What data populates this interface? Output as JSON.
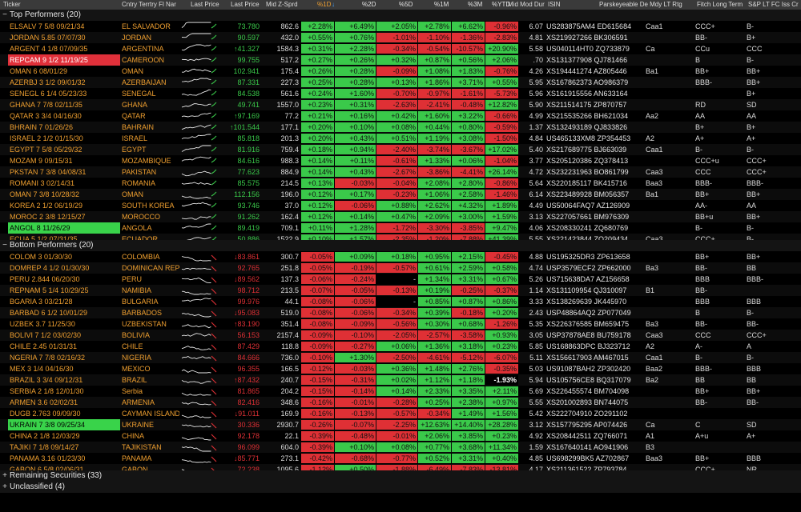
{
  "columns": {
    "ticker": "Ticker",
    "country": "Cntry Terrtry Fl Nar",
    "last_price_chart": "Last Price",
    "last_price": "Last Price",
    "mid_z": "Mid Z-Sprd",
    "p1d": "%1D",
    "p1d_sort": "↓",
    "p2d": "%2D",
    "p5d": "%5D",
    "p1m": "%1M",
    "p3m": "%3M",
    "pytd": "%YTD",
    "dur": "Mid Mod Dur",
    "isin": "ISIN",
    "moody": "Parskeyeable De Mdy LT Rtg",
    "fitch": "Fitch Long Term",
    "sp": "S&P LT FC Iss Cr"
  },
  "groups": {
    "top": {
      "label": "Top Performers (20)",
      "toggle": "−"
    },
    "bottom": {
      "label": "Bottom Performers (20)",
      "toggle": "−"
    },
    "remaining": {
      "label": "Remaining Securities (33)",
      "toggle": "+"
    },
    "unclassified": {
      "label": "Unclassified (4)",
      "toggle": "+"
    }
  },
  "colors": {
    "up": "#3ac94a",
    "down": "#df3035",
    "orange": "#f0a030"
  },
  "top_rows": [
    {
      "ticker": "ELSALV 7 5/8 09/21/34",
      "country": "EL SALVADOR",
      "lp": "73.780",
      "lp_dir": "",
      "z": "862.6",
      "d1": "+2.28%",
      "d2": "+6.49%",
      "d5": "+2.05%",
      "m1": "+2.78%",
      "m3": "+6.62%",
      "ytd": "-0.96%",
      "dur": "6.07",
      "isin": "US283875AM4 ED615684",
      "moody": "Caa1",
      "fitch": "CCC+",
      "sp": "B-",
      "hl": ""
    },
    {
      "ticker": "JORDAN 5.85 07/07/30",
      "country": "JORDAN",
      "lp": "90.597",
      "lp_dir": "",
      "z": "432.0",
      "d1": "+0.55%",
      "d2": "+0.76%",
      "d5": "-1.01%",
      "m1": "-1.10%",
      "m3": "-1.36%",
      "ytd": "-2.83%",
      "dur": "4.81",
      "isin": "XS219927266 BK306591",
      "moody": "",
      "fitch": "BB-",
      "sp": "B+",
      "hl": ""
    },
    {
      "ticker": "ARGENT 4 1/8 07/09/35",
      "country": "ARGENTINA",
      "lp": "41.327",
      "lp_dir": "up",
      "z": "1584.3",
      "d1": "+0.31%",
      "d2": "+2.28%",
      "d5": "-0.34%",
      "m1": "-0.54%",
      "m3": "-10.57%",
      "ytd": "+20.90%",
      "dur": "5.58",
      "isin": "US040114HT0 ZQ733879",
      "moody": "Ca",
      "fitch": "CCu",
      "sp": "CCC",
      "hl": ""
    },
    {
      "ticker": "REPCAM 9 1/2 11/19/25",
      "country": "CAMEROON",
      "lp": "99.755",
      "lp_dir": "",
      "z": "517.2",
      "d1": "+0.27%",
      "d2": "+0.26%",
      "d5": "+0.32%",
      "m1": "+0.87%",
      "m3": "+0.56%",
      "ytd": "+2.06%",
      "dur": ".70",
      "isin": "XS131377908 QJ781466",
      "moody": "",
      "fitch": "B",
      "sp": "B-",
      "hl": "red"
    },
    {
      "ticker": "OMAN 6 08/01/29",
      "country": "OMAN",
      "lp": "102.941",
      "lp_dir": "",
      "z": "175.4",
      "d1": "+0.26%",
      "d2": "+0.28%",
      "d5": "-0.09%",
      "m1": "+1.08%",
      "m3": "+1.83%",
      "ytd": "-0.76%",
      "dur": "4.26",
      "isin": "XS194441274 AZ805446",
      "moody": "Ba1",
      "fitch": "BB+",
      "sp": "BB+",
      "hl": ""
    },
    {
      "ticker": "AZERBJ 3 1/2 09/01/32",
      "country": "AZERBAIJAN",
      "lp": "87.331",
      "lp_dir": "",
      "z": "227.3",
      "d1": "+0.25%",
      "d2": "+0.28%",
      "d5": "+0.13%",
      "m1": "+1.86%",
      "m3": "+3.71%",
      "ytd": "+0.55%",
      "dur": "5.95",
      "isin": "XS167862373 AO986379",
      "moody": "",
      "fitch": "BBB-",
      "sp": "BB+",
      "hl": ""
    },
    {
      "ticker": "SENEGL 6 1/4 05/23/33",
      "country": "SENEGAL",
      "lp": "84.538",
      "lp_dir": "",
      "z": "561.6",
      "d1": "+0.24%",
      "d2": "+1.60%",
      "d5": "-0.70%",
      "m1": "-0.97%",
      "m3": "-1.61%",
      "ytd": "-5.73%",
      "dur": "5.96",
      "isin": "XS161915556 AN633164",
      "moody": "",
      "fitch": "",
      "sp": "B+",
      "hl": ""
    },
    {
      "ticker": "GHANA 7 7/8 02/11/35",
      "country": "GHANA",
      "lp": "49.741",
      "lp_dir": "",
      "z": "1557.0",
      "d1": "+0.23%",
      "d2": "+0.31%",
      "d5": "-2.63%",
      "m1": "-2.41%",
      "m3": "-0.48%",
      "ytd": "+12.82%",
      "dur": "5.90",
      "isin": "XS211514175 ZP870757",
      "moody": "",
      "fitch": "RD",
      "sp": "SD",
      "hl": ""
    },
    {
      "ticker": "QATAR 3 3/4 04/16/30",
      "country": "QATAR",
      "lp": "97.169",
      "lp_dir": "up",
      "z": "77.2",
      "d1": "+0.21%",
      "d2": "+0.16%",
      "d5": "+0.42%",
      "m1": "+1.60%",
      "m3": "+3.22%",
      "ytd": "-0.66%",
      "dur": "4.99",
      "isin": "XS215535266 BH621034",
      "moody": "Aa2",
      "fitch": "AA",
      "sp": "AA",
      "hl": ""
    },
    {
      "ticker": "BHRAIN 7 01/26/26",
      "country": "BAHRAIN",
      "lp": "101.544",
      "lp_dir": "up",
      "z": "177.1",
      "d1": "+0.20%",
      "d2": "+0.10%",
      "d5": "+0.08%",
      "m1": "+0.44%",
      "m3": "+0.80%",
      "ytd": "-0.59%",
      "dur": "1.37",
      "isin": "XS132493189 QJ833826",
      "moody": "",
      "fitch": "B+",
      "sp": "B+",
      "hl": ""
    },
    {
      "ticker": "ISRAEL 2 1/2 01/15/30",
      "country": "ISRAEL",
      "lp": "85.818",
      "lp_dir": "",
      "z": "201.3",
      "d1": "+0.20%",
      "d2": "+0.43%",
      "d5": "+0.51%",
      "m1": "+1.19%",
      "m3": "+3.08%",
      "ytd": "-1.50%",
      "dur": "4.84",
      "isin": "US465133XM8 ZP354453",
      "moody": "A2",
      "fitch": "A+",
      "sp": "A+",
      "hl": ""
    },
    {
      "ticker": "EGYPT 7 5/8 05/29/32",
      "country": "EGYPT",
      "lp": "81.916",
      "lp_dir": "",
      "z": "759.4",
      "d1": "+0.18%",
      "d2": "+0.94%",
      "d5": "-2.40%",
      "m1": "-3.74%",
      "m3": "-3.67%",
      "ytd": "+17.02%",
      "dur": "5.40",
      "isin": "XS217689775 BJ663039",
      "moody": "Caa1",
      "fitch": "B-",
      "sp": "B-",
      "hl": ""
    },
    {
      "ticker": "MOZAM 9 09/15/31",
      "country": "MOZAMBIQUE",
      "lp": "84.616",
      "lp_dir": "",
      "z": "988.3",
      "d1": "+0.14%",
      "d2": "+0.11%",
      "d5": "-0.61%",
      "m1": "+1.33%",
      "m3": "+0.06%",
      "ytd": "-1.04%",
      "dur": "3.77",
      "isin": "XS205120386 ZQ378413",
      "moody": "",
      "fitch": "CCC+u",
      "sp": "CCC+",
      "hl": ""
    },
    {
      "ticker": "PKSTAN 7 3/8 04/08/31",
      "country": "PAKISTAN",
      "lp": "77.623",
      "lp_dir": "",
      "z": "884.9",
      "d1": "+0.14%",
      "d2": "+0.43%",
      "d5": "-2.67%",
      "m1": "-3.86%",
      "m3": "-4.41%",
      "ytd": "+26.14%",
      "dur": "4.72",
      "isin": "XS232231963 BO861799",
      "moody": "Caa3",
      "fitch": "CCC",
      "sp": "CCC+",
      "hl": ""
    },
    {
      "ticker": "ROMANI 3 02/14/31",
      "country": "ROMANIA",
      "lp": "85.575",
      "lp_dir": "",
      "z": "214.5",
      "d1": "+0.13%",
      "d2": "-0.03%",
      "d5": "-0.04%",
      "m1": "+2.08%",
      "m3": "+2.80%",
      "ytd": "-0.86%",
      "dur": "5.64",
      "isin": "XS220185117 BK415716",
      "moody": "Baa3",
      "fitch": "BBB-",
      "sp": "BBB-",
      "hl": ""
    },
    {
      "ticker": "OMAN 7 3/8 10/28/32",
      "country": "OMAN",
      "lp": "112.156",
      "lp_dir": "",
      "z": "196.0",
      "d1": "+0.12%",
      "d2": "+0.17%",
      "d5": "-0.23%",
      "m1": "+1.06%",
      "m3": "+2.58%",
      "ytd": "-1.46%",
      "dur": "6.14",
      "isin": "XS223489928 BM056357",
      "moody": "Ba1",
      "fitch": "BB+",
      "sp": "BB+",
      "hl": ""
    },
    {
      "ticker": "KOREA 2 1/2 06/19/29",
      "country": "SOUTH KOREA",
      "lp": "93.746",
      "lp_dir": "",
      "z": "37.0",
      "d1": "+0.12%",
      "d2": "-0.06%",
      "d5": "+0.88%",
      "m1": "+2.62%",
      "m3": "+4.32%",
      "ytd": "+1.89%",
      "dur": "4.49",
      "isin": "US50064FAQ7 AZ126909",
      "moody": "",
      "fitch": "AA-",
      "sp": "AA",
      "hl": ""
    },
    {
      "ticker": "MOROC 2 3/8 12/15/27",
      "country": "MOROCCO",
      "lp": "91.262",
      "lp_dir": "",
      "z": "162.4",
      "d1": "+0.12%",
      "d2": "+0.14%",
      "d5": "+0.47%",
      "m1": "+2.09%",
      "m3": "+3.00%",
      "ytd": "+1.59%",
      "dur": "3.13",
      "isin": "XS227057661 BM976309",
      "moody": "",
      "fitch": "BB+u",
      "sp": "BB+",
      "hl": ""
    },
    {
      "ticker": "ANGOL 8 11/26/29",
      "country": "ANGOLA",
      "lp": "89.419",
      "lp_dir": "",
      "z": "709.1",
      "d1": "+0.11%",
      "d2": "+1.28%",
      "d5": "-1.72%",
      "m1": "-3.30%",
      "m3": "-3.85%",
      "ytd": "+9.47%",
      "dur": "4.06",
      "isin": "XS208330241 ZQ680769",
      "moody": "",
      "fitch": "B-",
      "sp": "B-",
      "hl": "grn"
    },
    {
      "ticker": "ECUA 5 1/2 07/31/35",
      "country": "ECUADOR",
      "lp": "50.886",
      "lp_dir": "",
      "z": "1522.9",
      "d1": "+0.10%",
      "d2": "+1.57%",
      "d5": "-2.35%",
      "m1": "-1.20%",
      "m3": "-7.88%",
      "ytd": "+41.39%",
      "dur": "5.55",
      "isin": "XS221423844 ZO209434",
      "moody": "Caa3",
      "fitch": "CCC+",
      "sp": "B-",
      "hl": ""
    }
  ],
  "bottom_rows": [
    {
      "ticker": "COLOM 3 01/30/30",
      "country": "COLOMBIA",
      "lp": "83.861",
      "lp_dir": "down",
      "z": "300.7",
      "d1": "-0.05%",
      "d2": "+0.09%",
      "d5": "+0.18%",
      "m1": "+0.95%",
      "m3": "+2.15%",
      "ytd": "-0.45%",
      "dur": "4.88",
      "isin": "US195325DR3 ZP613658",
      "moody": "",
      "fitch": "BB+",
      "sp": "BB+",
      "hl": ""
    },
    {
      "ticker": "DOMREP 4 1/2 01/30/30",
      "country": "DOMINICAN REP",
      "lp": "92.765",
      "lp_dir": "",
      "z": "251.8",
      "d1": "-0.05%",
      "d2": "-0.19%",
      "d5": "-0.57%",
      "m1": "+0.61%",
      "m3": "+2.59%",
      "ytd": "+0.58%",
      "dur": "4.74",
      "isin": "USP3579ECF2 ZP662000",
      "moody": "Ba3",
      "fitch": "BB-",
      "sp": "BB",
      "hl": ""
    },
    {
      "ticker": "PERU 2.844 06/20/30",
      "country": "PERU",
      "lp": "89.562",
      "lp_dir": "down",
      "z": "137.3",
      "d1": "-0.06%",
      "d2": "-0.24%",
      "d5": "-",
      "m1": "+1.34%",
      "m3": "+3.31%",
      "ytd": "+0.67%",
      "dur": "5.26",
      "isin": "US715638DA7 AZ156658",
      "moody": "",
      "fitch": "BBB",
      "sp": "BBB-",
      "hl": ""
    },
    {
      "ticker": "REPNAM 5 1/4 10/29/25",
      "country": "NAMIBIA",
      "lp": "98.712",
      "lp_dir": "",
      "z": "213.5",
      "d1": "-0.07%",
      "d2": "-0.05%",
      "d5": "-0.13%",
      "m1": "+0.19%",
      "m3": "-0.25%",
      "ytd": "-0.37%",
      "dur": "1.14",
      "isin": "XS131109954 QJ310097",
      "moody": "B1",
      "fitch": "BB-",
      "sp": "",
      "hl": ""
    },
    {
      "ticker": "BGARIA 3 03/21/28",
      "country": "BULGARIA",
      "lp": "99.976",
      "lp_dir": "",
      "z": "44.1",
      "d1": "-0.08%",
      "d2": "-0.06%",
      "d5": "-",
      "m1": "+0.85%",
      "m3": "+0.87%",
      "ytd": "+0.86%",
      "dur": "3.33",
      "isin": "XS138269639 JK445970",
      "moody": "",
      "fitch": "BBB",
      "sp": "BBB",
      "hl": ""
    },
    {
      "ticker": "BARBAD 6 1/2 10/01/29",
      "country": "BARBADOS",
      "lp": "95.083",
      "lp_dir": "down",
      "z": "519.0",
      "d1": "-0.08%",
      "d2": "-0.06%",
      "d5": "-0.34%",
      "m1": "+0.39%",
      "m3": "-0.18%",
      "ytd": "+0.20%",
      "dur": "2.43",
      "isin": "USP48864AQ2 ZP077049",
      "moody": "",
      "fitch": "B",
      "sp": "B-",
      "hl": ""
    },
    {
      "ticker": "UZBEK 3.7 11/25/30",
      "country": "UZBEKISTAN",
      "lp": "83.190",
      "lp_dir": "up",
      "z": "351.4",
      "d1": "-0.08%",
      "d2": "-0.09%",
      "d5": "-0.56%",
      "m1": "+0.30%",
      "m3": "+0.68%",
      "ytd": "-1.26%",
      "dur": "5.35",
      "isin": "XS226376585 BM659475",
      "moody": "Ba3",
      "fitch": "BB-",
      "sp": "BB-",
      "hl": ""
    },
    {
      "ticker": "BOLIVI 7 1/2 03/02/30",
      "country": "BOLIVIA",
      "lp": "56.153",
      "lp_dir": "",
      "z": "2157.4",
      "d1": "-0.09%",
      "d2": "-0.10%",
      "d5": "-2.05%",
      "m1": "-2.57%",
      "m3": "-3.58%",
      "ytd": "+0.93%",
      "dur": "3.05",
      "isin": "USP37878AE8 BU759178",
      "moody": "Caa3",
      "fitch": "CCC",
      "sp": "CCC+",
      "hl": ""
    },
    {
      "ticker": "CHILE 2.45 01/31/31",
      "country": "CHILE",
      "lp": "87.429",
      "lp_dir": "",
      "z": "118.8",
      "d1": "-0.09%",
      "d2": "-0.27%",
      "d5": "+0.06%",
      "m1": "+1.36%",
      "m3": "+3.18%",
      "ytd": "+0.23%",
      "dur": "5.85",
      "isin": "US168863DPC BJ323712",
      "moody": "A2",
      "fitch": "A-",
      "sp": "A",
      "hl": ""
    },
    {
      "ticker": "NGERIA 7 7/8 02/16/32",
      "country": "NIGERIA",
      "lp": "84.666",
      "lp_dir": "",
      "z": "736.0",
      "d1": "-0.10%",
      "d2": "+1.30%",
      "d5": "-2.50%",
      "m1": "-4.61%",
      "m3": "-5.12%",
      "ytd": "-6.07%",
      "dur": "5.11",
      "isin": "XS156617903 AM467015",
      "moody": "Caa1",
      "fitch": "B-",
      "sp": "B-",
      "hl": ""
    },
    {
      "ticker": "MEX 3 1/4 04/16/30",
      "country": "MEXICO",
      "lp": "96.355",
      "lp_dir": "",
      "z": "166.5",
      "d1": "-0.12%",
      "d2": "-0.03%",
      "d5": "+0.36%",
      "m1": "+1.48%",
      "m3": "+2.76%",
      "ytd": "-0.35%",
      "dur": "5.03",
      "isin": "US91087BAH2 ZP302420",
      "moody": "Baa2",
      "fitch": "BBB-",
      "sp": "BBB",
      "hl": ""
    },
    {
      "ticker": "BRAZIL 3 3/4 09/12/31",
      "country": "BRAZIL",
      "lp": "87.432",
      "lp_dir": "up",
      "z": "240.7",
      "d1": "-0.15%",
      "d2": "-0.31%",
      "d5": "+0.02%",
      "m1": "+1.12%",
      "m3": "+1.18%",
      "ytd": "-1.93%",
      "dur": "5.94",
      "isin": "US105756CE8 BQ317079",
      "moody": "Ba2",
      "fitch": "BB",
      "sp": "BB",
      "hl": "",
      "ytd_black": true
    },
    {
      "ticker": "SERBIA 2 1/8 12/01/30",
      "country": "Serbia",
      "lp": "81.865",
      "lp_dir": "",
      "z": "204.2",
      "d1": "-0.15%",
      "d2": "-0.14%",
      "d5": "+0.14%",
      "m1": "+2.33%",
      "m3": "+3.35%",
      "ytd": "+2.11%",
      "dur": "5.69",
      "isin": "XS226455574 BM704098",
      "moody": "",
      "fitch": "BB+",
      "sp": "BB+",
      "hl": ""
    },
    {
      "ticker": "ARMEN 3.6 02/02/31",
      "country": "ARMENIA",
      "lp": "82.416",
      "lp_dir": "",
      "z": "348.6",
      "d1": "-0.16%",
      "d2": "-0.01%",
      "d5": "-0.28%",
      "m1": "+0.25%",
      "m3": "+2.38%",
      "ytd": "+0.97%",
      "dur": "5.55",
      "isin": "XS201002893 BN744075",
      "moody": "",
      "fitch": "BB-",
      "sp": "BB-",
      "hl": ""
    },
    {
      "ticker": "DUGB 2.763 09/09/30",
      "country": "CAYMAN ISLANDS",
      "lp": "91.011",
      "lp_dir": "down",
      "z": "169.9",
      "d1": "-0.16%",
      "d2": "-0.13%",
      "d5": "-0.57%",
      "m1": "-0.34%",
      "m3": "+1.49%",
      "ytd": "+1.56%",
      "dur": "5.42",
      "isin": "XS222704910 ZO291102",
      "moody": "",
      "fitch": "",
      "sp": "",
      "hl": ""
    },
    {
      "ticker": "UKRAIN 7 3/8 09/25/34",
      "country": "UKRAINE",
      "lp": "30.336",
      "lp_dir": "",
      "z": "2930.7",
      "d1": "-0.26%",
      "d2": "-0.07%",
      "d5": "-2.25%",
      "m1": "+12.63%",
      "m3": "+14.40%",
      "ytd": "+28.28%",
      "dur": "3.12",
      "isin": "XS157795295 AP074426",
      "moody": "Ca",
      "fitch": "C",
      "sp": "SD",
      "hl": "grn"
    },
    {
      "ticker": "CHINA 2 1/8 12/03/29",
      "country": "CHINA",
      "lp": "92.178",
      "lp_dir": "",
      "z": "22.1",
      "d1": "-0.39%",
      "d2": "-0.48%",
      "d5": "-0.01%",
      "m1": "+2.06%",
      "m3": "+3.85%",
      "ytd": "+0.23%",
      "dur": "4.92",
      "isin": "XS208442511 ZQ766071",
      "moody": "A1",
      "fitch": "A+u",
      "sp": "A+",
      "hl": ""
    },
    {
      "ticker": "TAJIKI 7 1/8 09/14/27",
      "country": "TAJIKISTAN",
      "lp": "96.099",
      "lp_dir": "",
      "z": "604.0",
      "d1": "-0.39%",
      "d2": "+0.10%",
      "d5": "+0.08%",
      "m1": "+0.77%",
      "m3": "+3.68%",
      "ytd": "+11.34%",
      "dur": "1.59",
      "isin": "XS167640141 AO941906",
      "moody": "B3",
      "fitch": "",
      "sp": "",
      "hl": ""
    },
    {
      "ticker": "PANAMA 3.16 01/23/30",
      "country": "PANAMA",
      "lp": "85.771",
      "lp_dir": "down",
      "z": "273.1",
      "d1": "-0.42%",
      "d2": "-0.68%",
      "d5": "-0.77%",
      "m1": "+0.52%",
      "m3": "+3.31%",
      "ytd": "+0.40%",
      "dur": "4.85",
      "isin": "US698299BK5 AZ702867",
      "moody": "Baa3",
      "fitch": "BB+",
      "sp": "BBB",
      "hl": ""
    },
    {
      "ticker": "GABON 6 5/8 02/06/31",
      "country": "GABON",
      "lp": "72.238",
      "lp_dir": "",
      "z": "1095.6",
      "d1": "-1.12%",
      "d2": "+0.50%",
      "d5": "-1.88%",
      "m1": "-6.49%",
      "m3": "-7.83%",
      "ytd": "-13.81%",
      "dur": "4.17",
      "isin": "XS211361522 ZP793784",
      "moody": "",
      "fitch": "CCC+",
      "sp": "NR",
      "hl": ""
    }
  ]
}
